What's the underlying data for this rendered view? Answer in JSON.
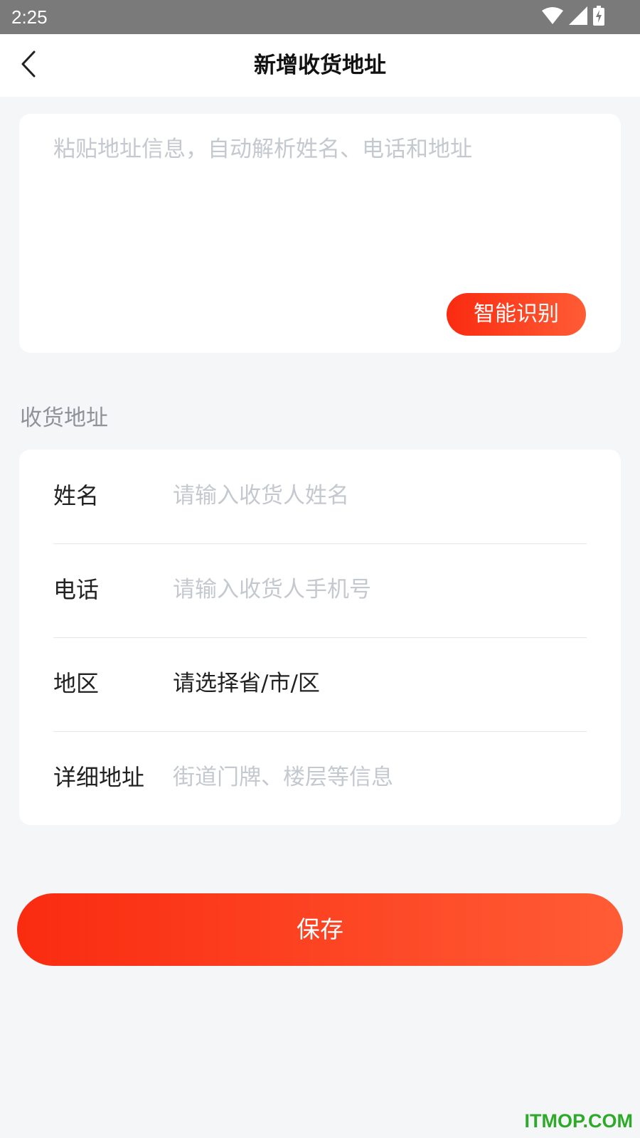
{
  "status_bar": {
    "time": "2:25",
    "icons": [
      "wifi-icon",
      "cellular-signal-icon",
      "battery-charging-icon"
    ]
  },
  "header": {
    "back_icon": "chevron-left-icon",
    "title": "新增收货地址"
  },
  "paste_box": {
    "placeholder": "粘贴地址信息，自动解析姓名、电话和地址",
    "value": "",
    "button_label": "智能识别"
  },
  "address_section": {
    "label": "收货地址",
    "fields": [
      {
        "label": "姓名",
        "placeholder": "请输入收货人姓名",
        "value": ""
      },
      {
        "label": "电话",
        "placeholder": "请输入收货人手机号",
        "value": ""
      },
      {
        "label": "地区",
        "value": "请选择省/市/区"
      },
      {
        "label": "详细地址",
        "placeholder": "街道门牌、楼层等信息",
        "value": ""
      }
    ]
  },
  "save_button": {
    "label": "保存"
  },
  "watermark": "ITMOP.COM",
  "colors": {
    "accent_start": "#fa2b10",
    "accent_end": "#ff5c35",
    "page_background": "#f5f6f8",
    "placeholder": "#c4c8cf",
    "watermark": "#2eaa2a"
  }
}
